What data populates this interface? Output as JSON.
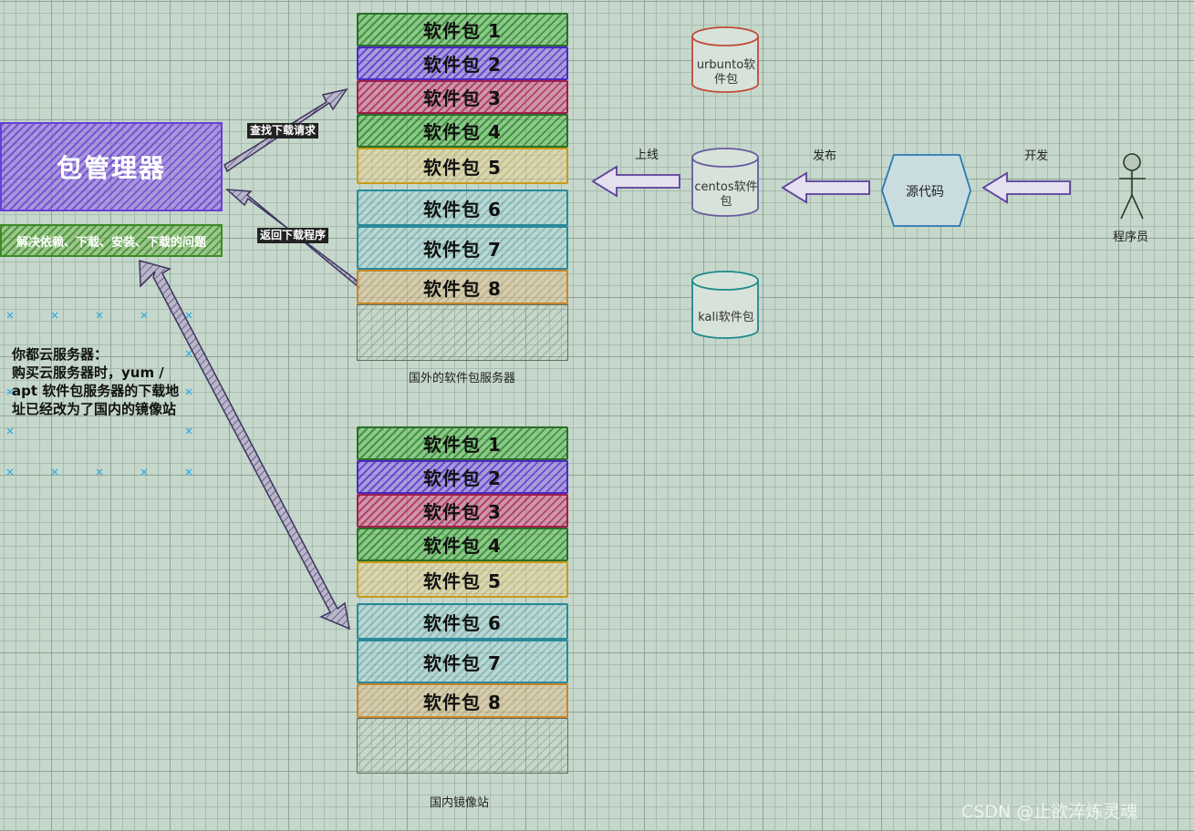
{
  "package_manager": {
    "title": "包管理器",
    "subtitle": "解决依赖、下载、安装、下载的问题"
  },
  "arrows": {
    "request": "查找下载请求",
    "return": "返回下载程序",
    "online": "上线",
    "publish": "发布",
    "develop": "开发"
  },
  "foreign_server": {
    "caption": "国外的软件包服务器",
    "packages": [
      "软件包 1",
      "软件包 2",
      "软件包 3",
      "软件包 4",
      "软件包 5",
      "软件包 6",
      "软件包 7",
      "软件包 8"
    ]
  },
  "mirror_server": {
    "caption": "国内镜像站",
    "packages": [
      "软件包 1",
      "软件包 2",
      "软件包 3",
      "软件包 4",
      "软件包 5",
      "软件包 6",
      "软件包 7",
      "软件包 8"
    ]
  },
  "repos": {
    "ubuntu": "urbunto软件包",
    "centos": "centos软件包",
    "kali": "kali软件包"
  },
  "source_code": "源代码",
  "programmer": "程序员",
  "note": {
    "title": "你都云服务器：",
    "body": "购买云服务器时，yum / apt 软件包服务器的下载地址已经改为了国内的镜像站"
  },
  "watermark": "CSDN @止欲淬炼灵魂",
  "colors": {
    "purple": "#6a3fd6",
    "green": "#2f8a2f",
    "magenta": "#b0265a",
    "yellow": "#d9a21a",
    "teal": "#2a8a9a",
    "orange": "#c8862a"
  }
}
